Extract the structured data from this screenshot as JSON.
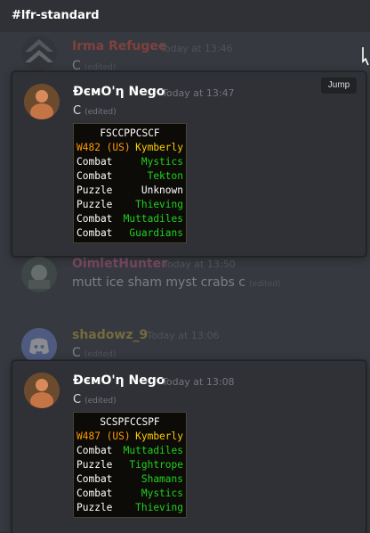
{
  "channel": {
    "title": "#lfr-standard"
  },
  "messages": [
    {
      "author": "Irma Refugee",
      "author_color": "#e74c3c",
      "time": "Today at 13:46",
      "content": "C",
      "edited": "(edited)"
    },
    {
      "author": "OimletHunter",
      "author_color": "#c85a8a",
      "time": "Today at 13:50",
      "content": "mutt ice sham myst crabs c",
      "edited": "(edited)"
    },
    {
      "author": "shadowz_9",
      "author_color": "#c9b13a",
      "time": "Today at 13:06",
      "content": "C",
      "edited": "(edited)"
    }
  ],
  "popups": [
    {
      "author": "ĐємΟ'η Nego",
      "time": "Today at 13:47",
      "content": "C",
      "edited": "(edited)",
      "jump_label": "Jump",
      "scout": {
        "code": "FSCCPPCSCF",
        "world": "W482 (US)",
        "world_boss": "Kymberly",
        "rows": [
          {
            "type": "Combat",
            "room": "Mystics",
            "known": true
          },
          {
            "type": "Combat",
            "room": "Tekton",
            "known": true
          },
          {
            "type": "Puzzle",
            "room": "Unknown",
            "known": false
          },
          {
            "type": "Puzzle",
            "room": "Thieving",
            "known": true
          },
          {
            "type": "Combat",
            "room": "Muttadiles",
            "known": true
          },
          {
            "type": "Combat",
            "room": "Guardians",
            "known": true
          }
        ]
      }
    },
    {
      "author": "ĐємΟ'η Nego",
      "time": "Today at 13:08",
      "content": "C",
      "edited": "(edited)",
      "scout": {
        "code": "SCSPFCCSPF",
        "world": "W487 (US)",
        "world_boss": "Kymberly",
        "rows": [
          {
            "type": "Combat",
            "room": "Muttadiles",
            "known": true
          },
          {
            "type": "Puzzle",
            "room": "Tightrope",
            "known": true
          },
          {
            "type": "Combat",
            "room": "Shamans",
            "known": true
          },
          {
            "type": "Combat",
            "room": "Mystics",
            "known": true
          },
          {
            "type": "Puzzle",
            "room": "Thieving",
            "known": true
          }
        ]
      }
    }
  ]
}
